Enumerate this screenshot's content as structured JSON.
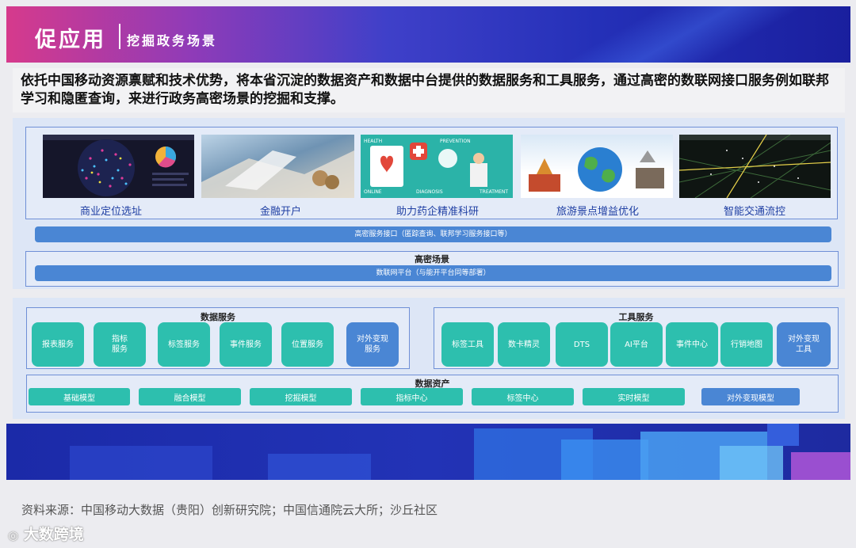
{
  "header": {
    "title": "促应用",
    "subtitle": "挖掘政务场景"
  },
  "intro": "依托中国移动资源禀赋和技术优势，将本省沉淀的数据资产和数据中台提供的数据服务和工具服务，通过高密的数联网接口服务例如联邦学习和隐匿查询，来进行政务高密场景的挖掘和支撑。",
  "scenarios": [
    {
      "label": "商业定位选址"
    },
    {
      "label": "金融开户"
    },
    {
      "label": "助力药企精准科研"
    },
    {
      "label": "旅游景点增益优化"
    },
    {
      "label": "智能交通流控"
    }
  ],
  "health_panel": {
    "words": [
      "HEALTH",
      "PREVENTION",
      "ONLINE",
      "TREATMENT",
      "DIAGNOSIS"
    ]
  },
  "interface_bar": "高密服务接口（匿踪查询、联邦学习服务接口等）",
  "scene_title": "高密场景",
  "platform_bar": "数联网平台（与能开平台同等部署）",
  "data_services": {
    "title": "数据服务",
    "items": [
      "报表服务",
      "指标\n服务",
      "标签服务",
      "事件服务",
      "位置服务",
      "对外变现\n服务"
    ]
  },
  "tool_services": {
    "title": "工具服务",
    "items": [
      "标签工具",
      "数卡精灵",
      "DTS",
      "AI平台",
      "事件中心",
      "行销地图",
      "对外变现\n工具"
    ]
  },
  "data_assets": {
    "title": "数据资产",
    "items": [
      "基础模型",
      "融合模型",
      "挖掘模型",
      "指标中心",
      "标签中心",
      "实时模型",
      "对外变现模型"
    ]
  },
  "source": "资料来源：中国移动大数据（贵阳）创新研究院；中国信通院云大所；沙丘社区",
  "watermark": "大数跨境",
  "colors": {
    "teal": "#2dbfae",
    "blue": "#4a86d4",
    "border": "#6f8fd6",
    "label": "#1f3fa3"
  }
}
